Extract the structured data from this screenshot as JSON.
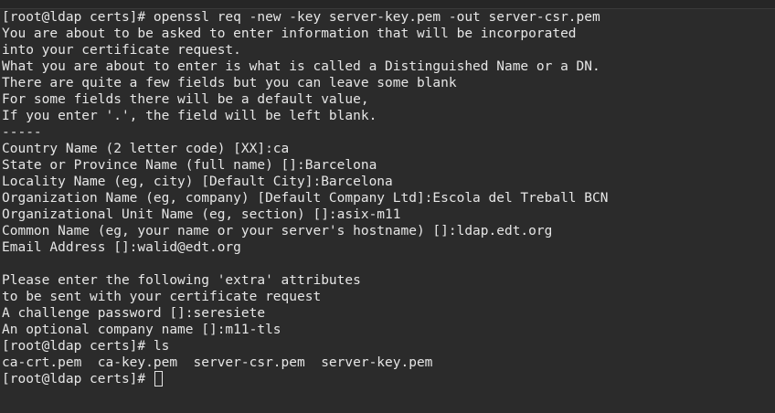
{
  "terminal": {
    "lines": [
      "[root@ldap certs]# openssl req -new -key server-key.pem -out server-csr.pem",
      "You are about to be asked to enter information that will be incorporated",
      "into your certificate request.",
      "What you are about to enter is what is called a Distinguished Name or a DN.",
      "There are quite a few fields but you can leave some blank",
      "For some fields there will be a default value,",
      "If you enter '.', the field will be left blank.",
      "-----",
      "Country Name (2 letter code) [XX]:ca",
      "State or Province Name (full name) []:Barcelona",
      "Locality Name (eg, city) [Default City]:Barcelona",
      "Organization Name (eg, company) [Default Company Ltd]:Escola del Treball BCN",
      "Organizational Unit Name (eg, section) []:asix-m11",
      "Common Name (eg, your name or your server's hostname) []:ldap.edt.org",
      "Email Address []:walid@edt.org",
      "",
      "Please enter the following 'extra' attributes",
      "to be sent with your certificate request",
      "A challenge password []:seresiete",
      "An optional company name []:m11-tls",
      "[root@ldap certs]# ls",
      "ca-crt.pem  ca-key.pem  server-csr.pem  server-key.pem"
    ],
    "prompt": "[root@ldap certs]# "
  },
  "colors": {
    "background": "#2b2b2b",
    "foreground": "#e6e6e6"
  }
}
